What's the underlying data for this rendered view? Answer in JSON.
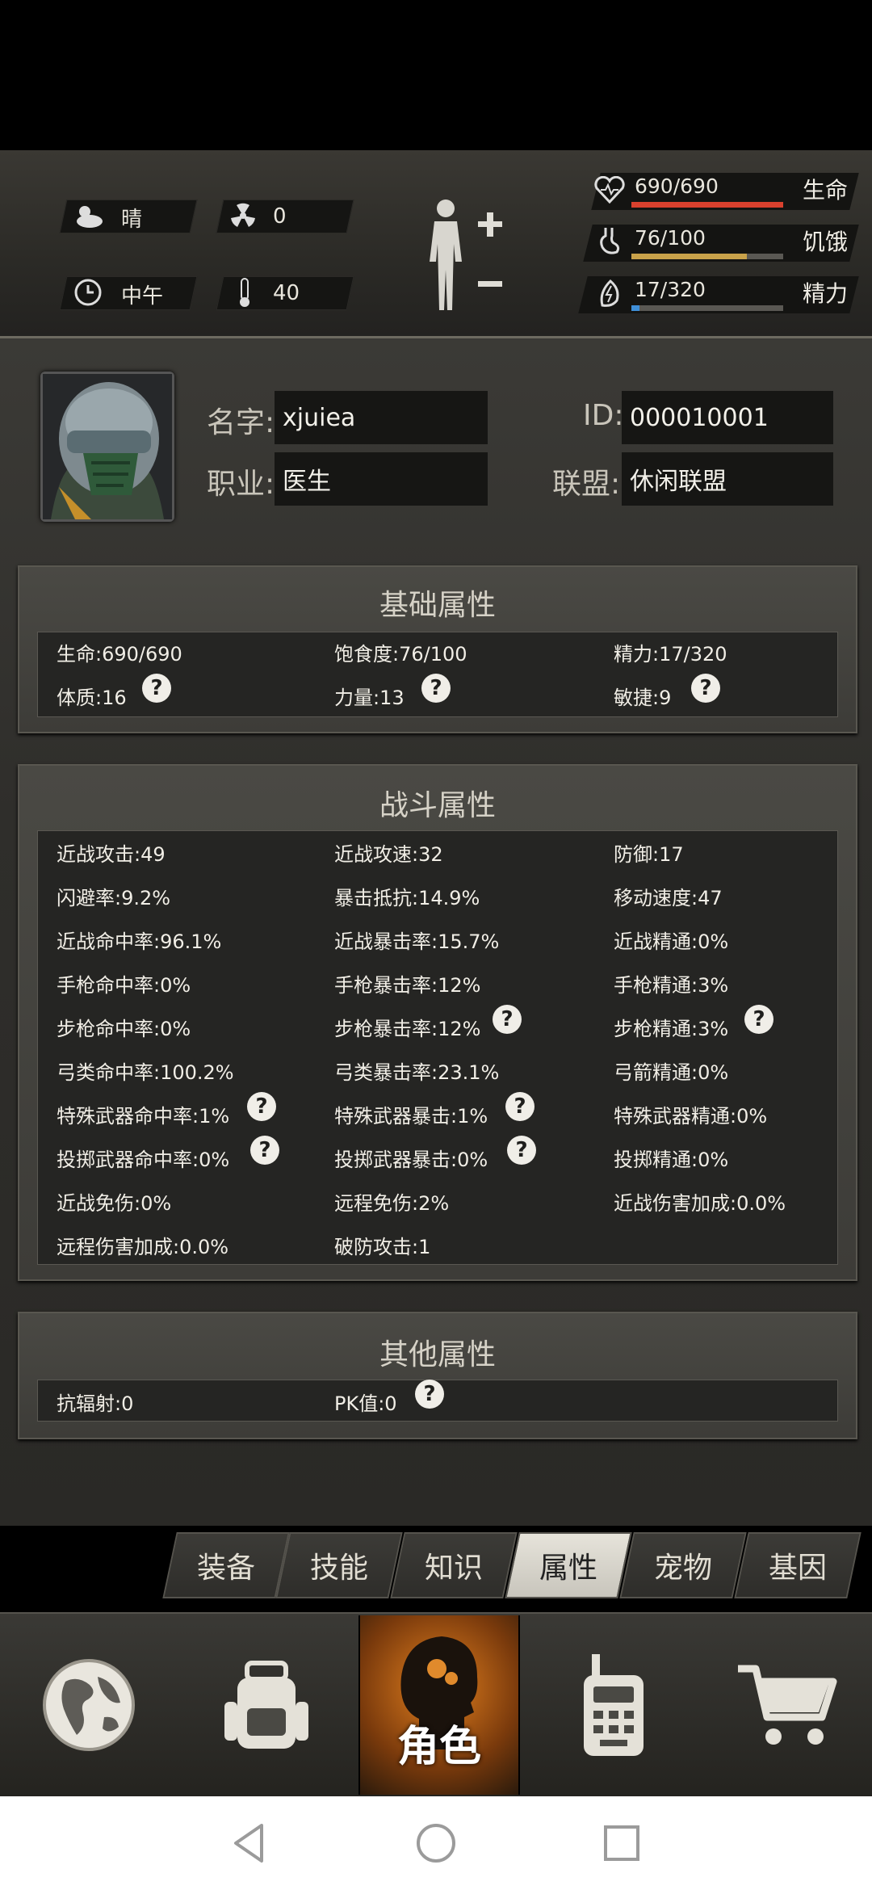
{
  "hud": {
    "weather": "晴",
    "radiation": "0",
    "time_of_day": "中午",
    "temperature": "40",
    "stats": [
      {
        "value": "690/690",
        "label": "生命",
        "fraction": 1.0,
        "color": "#d9412e",
        "icon": "heart-icon"
      },
      {
        "value": "76/100",
        "label": "饥饿",
        "fraction": 0.76,
        "color": "#c9a24a",
        "icon": "stomach-icon"
      },
      {
        "value": "17/320",
        "label": "精力",
        "fraction": 0.053,
        "color": "#3f8fd8",
        "icon": "energy-icon"
      }
    ]
  },
  "profile": {
    "name_label": "名字:",
    "name": "xjuiea",
    "id_label": "ID:",
    "id": "000010001",
    "job_label": "职业:",
    "job": "医生",
    "alliance_label": "联盟:",
    "alliance": "休闲联盟"
  },
  "sections": {
    "basic": {
      "title": "基础属性",
      "items": [
        "生命:690/690",
        "饱食度:76/100",
        "精力:17/320",
        "体质:16",
        "力量:13",
        "敏捷:9"
      ]
    },
    "combat": {
      "title": "战斗属性",
      "items": [
        "近战攻击:49",
        "近战攻速:32",
        "防御:17",
        "闪避率:9.2%",
        "暴击抵抗:14.9%",
        "移动速度:47",
        "近战命中率:96.1%",
        "近战暴击率:15.7%",
        "近战精通:0%",
        "手枪命中率:0%",
        "手枪暴击率:12%",
        "手枪精通:3%",
        "步枪命中率:0%",
        "步枪暴击率:12%",
        "步枪精通:3%",
        "弓类命中率:100.2%",
        "弓类暴击率:23.1%",
        "弓箭精通:0%",
        "特殊武器命中率:1%",
        "特殊武器暴击:1%",
        "特殊武器精通:0%",
        "投掷武器命中率:0%",
        "投掷武器暴击:0%",
        "投掷精通:0%",
        "近战免伤:0%",
        "远程免伤:2%",
        "近战伤害加成:0.0%",
        "远程伤害加成:0.0%",
        "破防攻击:1"
      ]
    },
    "other": {
      "title": "其他属性",
      "items": [
        "抗辐射:0",
        "PK值:0"
      ]
    }
  },
  "help_glyph": "?",
  "tabs": [
    "装备",
    "技能",
    "知识",
    "属性",
    "宠物",
    "基因"
  ],
  "active_tab": "属性",
  "bottom_nav": {
    "active_label": "角色",
    "icons": [
      "globe-icon",
      "backpack-icon",
      "character-icon",
      "walkie-talkie-icon",
      "cart-icon"
    ]
  }
}
